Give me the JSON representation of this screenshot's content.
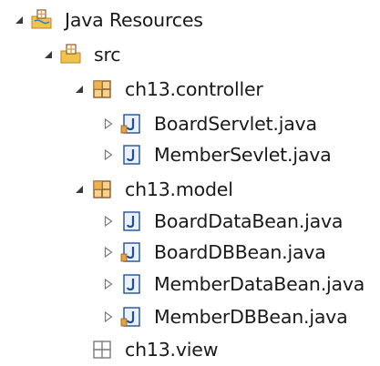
{
  "tree": {
    "java_resources": {
      "label": "Java Resources",
      "icon": "java-resources-folder-icon",
      "expanded": true
    },
    "src": {
      "label": "src",
      "icon": "source-folder-icon",
      "expanded": true
    },
    "controller": {
      "label": "ch13.controller",
      "icon": "package-icon",
      "expanded": true,
      "files": [
        {
          "label": "BoardServlet.java",
          "icon": "java-file-icon"
        },
        {
          "label": "MemberSevlet.java",
          "icon": "java-file-icon"
        }
      ]
    },
    "model": {
      "label": "ch13.model",
      "icon": "package-icon",
      "expanded": true,
      "files": [
        {
          "label": "BoardDataBean.java",
          "icon": "java-file-icon"
        },
        {
          "label": "BoardDBBean.java",
          "icon": "java-file-icon"
        },
        {
          "label": "MemberDataBean.java",
          "icon": "java-file-icon"
        },
        {
          "label": "MemberDBBean.java",
          "icon": "java-file-icon"
        }
      ]
    },
    "view": {
      "label": "ch13.view",
      "icon": "empty-package-icon"
    }
  },
  "colors": {
    "package_brown": "#8a5a2c",
    "package_orange": "#e8a23c",
    "java_blue": "#1f4f9c",
    "folder_yellow": "#f0c44c"
  }
}
